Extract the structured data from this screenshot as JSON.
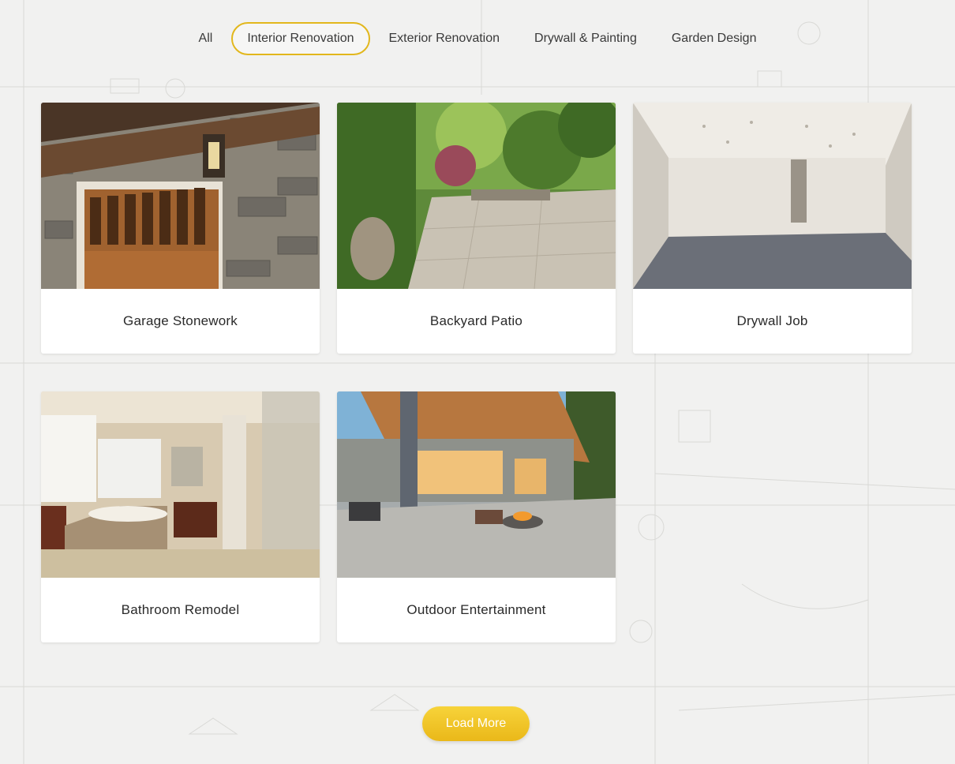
{
  "filters": {
    "items": [
      {
        "label": "All"
      },
      {
        "label": "Interior Renovation"
      },
      {
        "label": "Exterior Renovation"
      },
      {
        "label": "Drywall & Painting"
      },
      {
        "label": "Garden Design"
      }
    ],
    "active_label": "Interior Renovation"
  },
  "projects": [
    {
      "title": "Garage Stonework"
    },
    {
      "title": "Backyard Patio"
    },
    {
      "title": "Drywall Job"
    },
    {
      "title": "Bathroom Remodel"
    },
    {
      "title": "Outdoor Entertainment"
    }
  ],
  "load_more_label": "Load More",
  "colors": {
    "accent": "#e2b71c",
    "button": "#f2c625",
    "background": "#f1f1f0",
    "card": "#ffffff"
  }
}
